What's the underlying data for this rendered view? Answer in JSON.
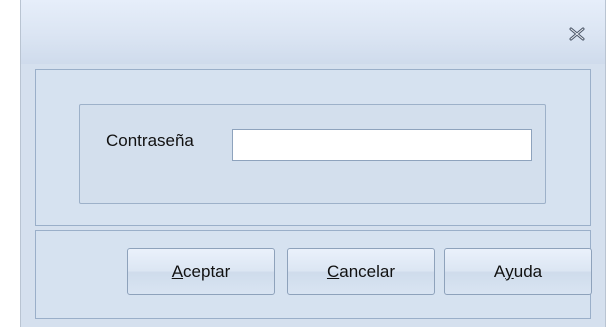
{
  "window": {
    "close_icon": "close-x-icon"
  },
  "form": {
    "password_label": "Contraseña",
    "password_value": "",
    "password_placeholder": ""
  },
  "buttons": {
    "accept": {
      "mnemonic": "A",
      "rest": "ceptar"
    },
    "cancel": {
      "mnemonic": "C",
      "rest": "ancelar"
    },
    "help": {
      "before": "A",
      "mnemonic": "y",
      "after": "uda"
    }
  },
  "colors": {
    "panel": "#d6e2f0",
    "border": "#9aafc9",
    "input_background": "#ffffff"
  }
}
